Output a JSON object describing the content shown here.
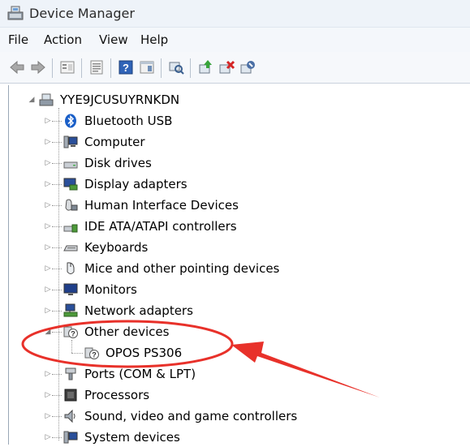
{
  "window": {
    "title": "Device Manager"
  },
  "menu": [
    "File",
    "Action",
    "View",
    "Help"
  ],
  "toolbar": {
    "buttons": [
      "back-icon",
      "forward-icon",
      "properties-icon",
      "list-icon",
      "help-icon",
      "view-icon",
      "scan-hardware-icon",
      "update-driver-icon",
      "uninstall-icon",
      "disable-icon"
    ]
  },
  "tree": {
    "root": "YYE9JCUSUYRNKDN",
    "categories": [
      "Bluetooth USB",
      "Computer",
      "Disk drives",
      "Display adapters",
      "Human Interface Devices",
      "IDE ATA/ATAPI controllers",
      "Keyboards",
      "Mice and other pointing devices",
      "Monitors",
      "Network adapters",
      "Other devices",
      "OPOS PS306",
      "Ports (COM & LPT)",
      "Processors",
      "Sound, video and game controllers",
      "System devices"
    ]
  },
  "colors": {
    "annotation": "#e8312a",
    "bluetooth": "#1a5fc8"
  }
}
